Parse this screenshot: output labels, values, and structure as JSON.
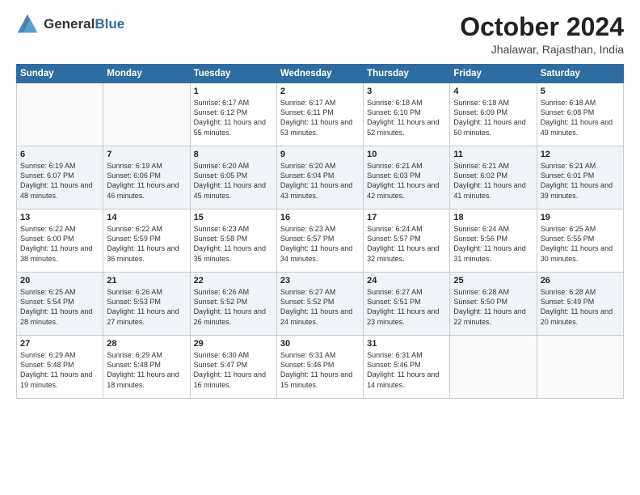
{
  "logo": {
    "general": "General",
    "blue": "Blue"
  },
  "title": "October 2024",
  "location": "Jhalawar, Rajasthan, India",
  "days_of_week": [
    "Sunday",
    "Monday",
    "Tuesday",
    "Wednesday",
    "Thursday",
    "Friday",
    "Saturday"
  ],
  "weeks": [
    [
      {
        "day": "",
        "info": ""
      },
      {
        "day": "",
        "info": ""
      },
      {
        "day": "1",
        "info": "Sunrise: 6:17 AM\nSunset: 6:12 PM\nDaylight: 11 hours and 55 minutes."
      },
      {
        "day": "2",
        "info": "Sunrise: 6:17 AM\nSunset: 6:11 PM\nDaylight: 11 hours and 53 minutes."
      },
      {
        "day": "3",
        "info": "Sunrise: 6:18 AM\nSunset: 6:10 PM\nDaylight: 11 hours and 52 minutes."
      },
      {
        "day": "4",
        "info": "Sunrise: 6:18 AM\nSunset: 6:09 PM\nDaylight: 11 hours and 50 minutes."
      },
      {
        "day": "5",
        "info": "Sunrise: 6:18 AM\nSunset: 6:08 PM\nDaylight: 11 hours and 49 minutes."
      }
    ],
    [
      {
        "day": "6",
        "info": "Sunrise: 6:19 AM\nSunset: 6:07 PM\nDaylight: 11 hours and 48 minutes."
      },
      {
        "day": "7",
        "info": "Sunrise: 6:19 AM\nSunset: 6:06 PM\nDaylight: 11 hours and 46 minutes."
      },
      {
        "day": "8",
        "info": "Sunrise: 6:20 AM\nSunset: 6:05 PM\nDaylight: 11 hours and 45 minutes."
      },
      {
        "day": "9",
        "info": "Sunrise: 6:20 AM\nSunset: 6:04 PM\nDaylight: 11 hours and 43 minutes."
      },
      {
        "day": "10",
        "info": "Sunrise: 6:21 AM\nSunset: 6:03 PM\nDaylight: 11 hours and 42 minutes."
      },
      {
        "day": "11",
        "info": "Sunrise: 6:21 AM\nSunset: 6:02 PM\nDaylight: 11 hours and 41 minutes."
      },
      {
        "day": "12",
        "info": "Sunrise: 6:21 AM\nSunset: 6:01 PM\nDaylight: 11 hours and 39 minutes."
      }
    ],
    [
      {
        "day": "13",
        "info": "Sunrise: 6:22 AM\nSunset: 6:00 PM\nDaylight: 11 hours and 38 minutes."
      },
      {
        "day": "14",
        "info": "Sunrise: 6:22 AM\nSunset: 5:59 PM\nDaylight: 11 hours and 36 minutes."
      },
      {
        "day": "15",
        "info": "Sunrise: 6:23 AM\nSunset: 5:58 PM\nDaylight: 11 hours and 35 minutes."
      },
      {
        "day": "16",
        "info": "Sunrise: 6:23 AM\nSunset: 5:57 PM\nDaylight: 11 hours and 34 minutes."
      },
      {
        "day": "17",
        "info": "Sunrise: 6:24 AM\nSunset: 5:57 PM\nDaylight: 11 hours and 32 minutes."
      },
      {
        "day": "18",
        "info": "Sunrise: 6:24 AM\nSunset: 5:56 PM\nDaylight: 11 hours and 31 minutes."
      },
      {
        "day": "19",
        "info": "Sunrise: 6:25 AM\nSunset: 5:55 PM\nDaylight: 11 hours and 30 minutes."
      }
    ],
    [
      {
        "day": "20",
        "info": "Sunrise: 6:25 AM\nSunset: 5:54 PM\nDaylight: 11 hours and 28 minutes."
      },
      {
        "day": "21",
        "info": "Sunrise: 6:26 AM\nSunset: 5:53 PM\nDaylight: 11 hours and 27 minutes."
      },
      {
        "day": "22",
        "info": "Sunrise: 6:26 AM\nSunset: 5:52 PM\nDaylight: 11 hours and 26 minutes."
      },
      {
        "day": "23",
        "info": "Sunrise: 6:27 AM\nSunset: 5:52 PM\nDaylight: 11 hours and 24 minutes."
      },
      {
        "day": "24",
        "info": "Sunrise: 6:27 AM\nSunset: 5:51 PM\nDaylight: 11 hours and 23 minutes."
      },
      {
        "day": "25",
        "info": "Sunrise: 6:28 AM\nSunset: 5:50 PM\nDaylight: 11 hours and 22 minutes."
      },
      {
        "day": "26",
        "info": "Sunrise: 6:28 AM\nSunset: 5:49 PM\nDaylight: 11 hours and 20 minutes."
      }
    ],
    [
      {
        "day": "27",
        "info": "Sunrise: 6:29 AM\nSunset: 5:48 PM\nDaylight: 11 hours and 19 minutes."
      },
      {
        "day": "28",
        "info": "Sunrise: 6:29 AM\nSunset: 5:48 PM\nDaylight: 11 hours and 18 minutes."
      },
      {
        "day": "29",
        "info": "Sunrise: 6:30 AM\nSunset: 5:47 PM\nDaylight: 11 hours and 16 minutes."
      },
      {
        "day": "30",
        "info": "Sunrise: 6:31 AM\nSunset: 5:46 PM\nDaylight: 11 hours and 15 minutes."
      },
      {
        "day": "31",
        "info": "Sunrise: 6:31 AM\nSunset: 5:46 PM\nDaylight: 11 hours and 14 minutes."
      },
      {
        "day": "",
        "info": ""
      },
      {
        "day": "",
        "info": ""
      }
    ]
  ]
}
